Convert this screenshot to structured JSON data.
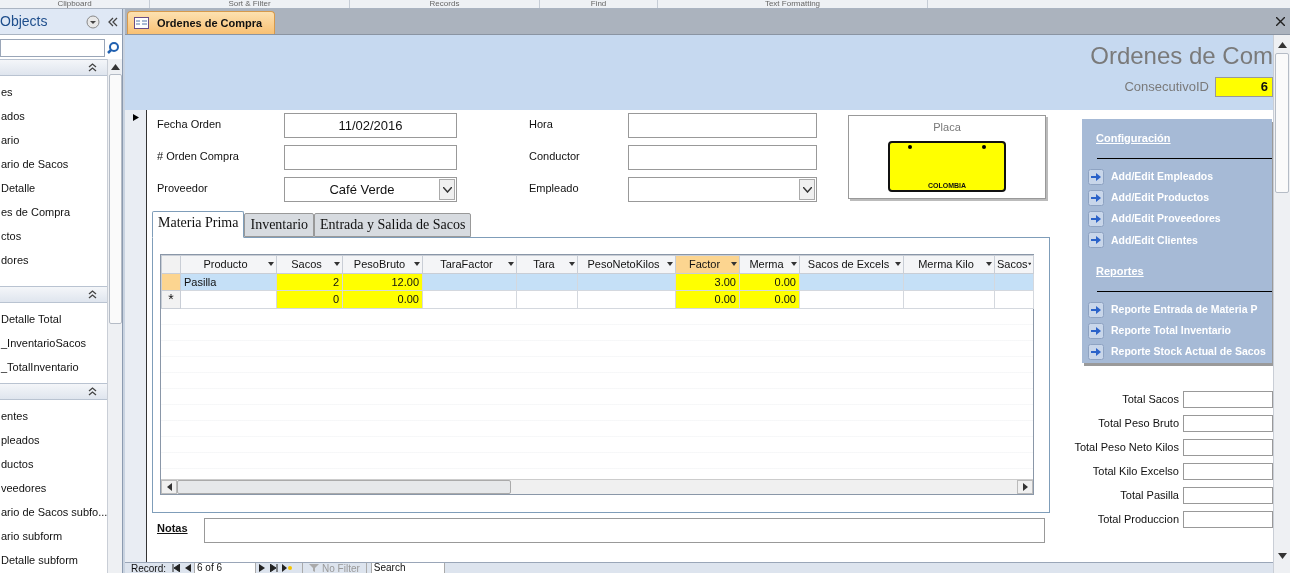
{
  "ribbon_groups": [
    "Clipboard",
    "Sort & Filter",
    "Records",
    "Find",
    "Text Formatting"
  ],
  "nav_pane": {
    "title": "Objects",
    "groups": [
      {
        "items": [
          "es",
          "ados",
          "ario",
          "ario de Sacos",
          "Detalle",
          "es de Compra",
          "ctos",
          "dores"
        ]
      },
      {
        "items": [
          "Detalle Total",
          "_InventarioSacos",
          "_TotalInventario"
        ]
      },
      {
        "items": [
          "entes",
          "pleados",
          "ductos",
          "veedores",
          "ario de Sacos subfo...",
          "ario subform",
          "Detalle subform"
        ]
      }
    ]
  },
  "document_tab": {
    "label": "Ordenes de Compra"
  },
  "form": {
    "title": "Ordenes de Com",
    "consecutivo": {
      "label": "ConsecutivoID",
      "value": "6"
    },
    "fields": [
      {
        "label": "Fecha Orden",
        "value": "11/02/2016",
        "kind": "text"
      },
      {
        "label": "Hora",
        "kind": "text"
      },
      {
        "label": "# Orden Compra",
        "kind": "text"
      },
      {
        "label": "Conductor",
        "kind": "text"
      },
      {
        "label": "Proveedor",
        "value": "Café Verde",
        "kind": "combo"
      },
      {
        "label": "Empleado",
        "kind": "combo"
      }
    ],
    "placa": {
      "label": "Placa",
      "plate_text": "COLOMBIA"
    },
    "tabs": [
      {
        "label": "Materia Prima",
        "selected": true
      },
      {
        "label": "Inventario",
        "selected": false
      },
      {
        "label": "Entrada y Salida de Sacos",
        "selected": false
      }
    ],
    "datasheet": {
      "columns": [
        {
          "label": "Producto",
          "highlighted": false,
          "selected": false
        },
        {
          "label": "Sacos",
          "highlighted": true,
          "selected": false
        },
        {
          "label": "PesoBruto",
          "highlighted": true,
          "selected": false
        },
        {
          "label": "TaraFactor",
          "highlighted": false,
          "selected": false
        },
        {
          "label": "Tara",
          "highlighted": false,
          "selected": false
        },
        {
          "label": "PesoNetoKilos",
          "highlighted": false,
          "selected": false
        },
        {
          "label": "Factor",
          "highlighted": true,
          "selected": true
        },
        {
          "label": "Merma",
          "highlighted": true,
          "selected": false
        },
        {
          "label": "Sacos de Excels",
          "highlighted": false,
          "selected": false
        },
        {
          "label": "Merma Kilo",
          "highlighted": false,
          "selected": false
        },
        {
          "label": "Sacos",
          "highlighted": false,
          "selected": false
        }
      ],
      "rows": [
        {
          "selected": true,
          "cells": [
            "Pasilla",
            "2",
            "12.00",
            null,
            null,
            null,
            "3.00",
            "0.00",
            null,
            null,
            null
          ]
        },
        {
          "selected": false,
          "marker": "*",
          "cells": [
            null,
            "0",
            "0.00",
            null,
            null,
            null,
            "0.00",
            "0.00",
            null,
            null,
            null
          ]
        }
      ]
    },
    "notes": {
      "label": "Notas"
    },
    "menu": [
      {
        "kind": "heading",
        "label": "Configuración"
      },
      {
        "kind": "button",
        "label": "Add/Edit Empleados"
      },
      {
        "kind": "button",
        "label": "Add/Edit Productos"
      },
      {
        "kind": "button",
        "label": "Add/Edit Proveedores"
      },
      {
        "kind": "button",
        "label": "Add/Edit Clientes"
      },
      {
        "kind": "heading",
        "label": "Reportes"
      },
      {
        "kind": "button",
        "label": "Reporte Entrada de Materia P"
      },
      {
        "kind": "button",
        "label": "Reporte Total Inventario"
      },
      {
        "kind": "button",
        "label": "Reporte Stock Actual de Sacos"
      }
    ],
    "totals": [
      {
        "label": "Total Sacos"
      },
      {
        "label": "Total Peso Bruto"
      },
      {
        "label": "Total Peso Neto Kilos"
      },
      {
        "label": "Total Kilo Excelso"
      },
      {
        "label": "Total Pasilla"
      },
      {
        "label": "Total Produccion"
      }
    ]
  },
  "record_nav": {
    "label": "Record:",
    "position": "6 of 6",
    "filter": "No Filter",
    "search": "Search"
  }
}
